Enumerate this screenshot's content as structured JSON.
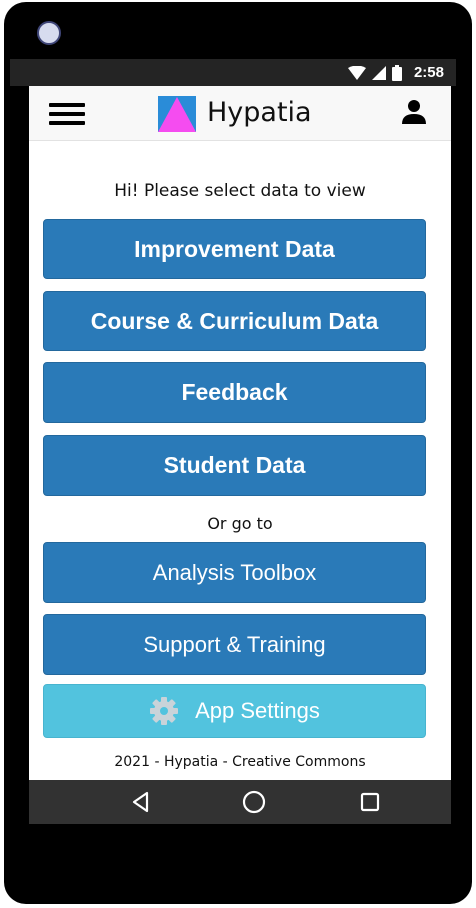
{
  "status_bar": {
    "time": "2:58",
    "icons": [
      "wifi-icon",
      "signal-icon",
      "battery-icon"
    ]
  },
  "app_bar": {
    "title": "Hypatia",
    "menu_icon": "hamburger-menu-icon",
    "account_icon": "user-icon"
  },
  "main": {
    "prompt": "Hi! Please select data to view",
    "primary_buttons": [
      {
        "label": "Improvement Data"
      },
      {
        "label": "Course & Curriculum Data"
      },
      {
        "label": "Feedback"
      },
      {
        "label": "Student Data"
      }
    ],
    "secondary_heading": "Or go to",
    "secondary_buttons": [
      {
        "label": "Analysis Toolbox"
      },
      {
        "label": "Support & Training"
      }
    ],
    "settings_button": {
      "label": "App Settings",
      "icon": "gear-icon"
    },
    "footer": "2021 - Hypatia - Creative Commons"
  },
  "nav_bar": {
    "buttons": [
      "back-icon",
      "home-icon",
      "recents-icon"
    ]
  },
  "colors": {
    "primary": "#2a7ab8",
    "settings": "#52c3de",
    "logo_magenta": "#f54cf0",
    "logo_blue": "#2a8cd8"
  }
}
